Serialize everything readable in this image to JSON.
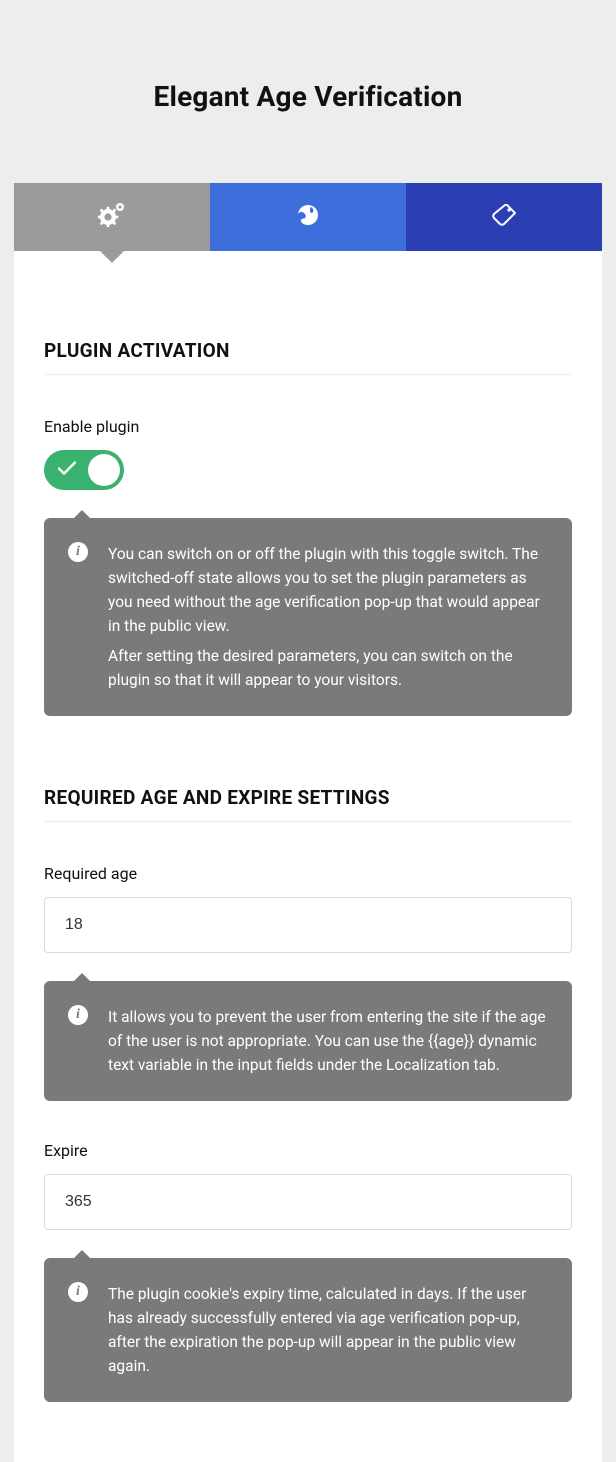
{
  "header": {
    "title": "Elegant Age Verification"
  },
  "tabs": {
    "settings": {
      "icon": "gears-icon"
    },
    "localization": {
      "icon": "globe-icon"
    },
    "style": {
      "icon": "tag-icon"
    }
  },
  "sections": {
    "activation": {
      "title": "PLUGIN ACTIVATION",
      "enable_label": "Enable plugin",
      "enabled": true,
      "info_line1": "You can switch on or off the plugin with this toggle switch. The switched-off state allows you to set the plugin parameters as you need without the age verification pop-up that would appear in the public view.",
      "info_line2": "After setting the desired parameters, you can switch on the plugin so that it will appear to your visitors."
    },
    "age_expire": {
      "title": "REQUIRED AGE AND EXPIRE SETTINGS",
      "required_age_label": "Required age",
      "required_age_value": "18",
      "required_age_info": "It allows you to prevent the user from entering the site if the age of the user is not appropriate. You can use the {{age}} dynamic text variable in the input fields under the Localization tab.",
      "expire_label": "Expire",
      "expire_value": "365",
      "expire_info": "The plugin cookie's expiry time, calculated in days. If the user has already successfully entered via age verification pop-up, after the expiration the pop-up will appear in the public view again."
    }
  }
}
